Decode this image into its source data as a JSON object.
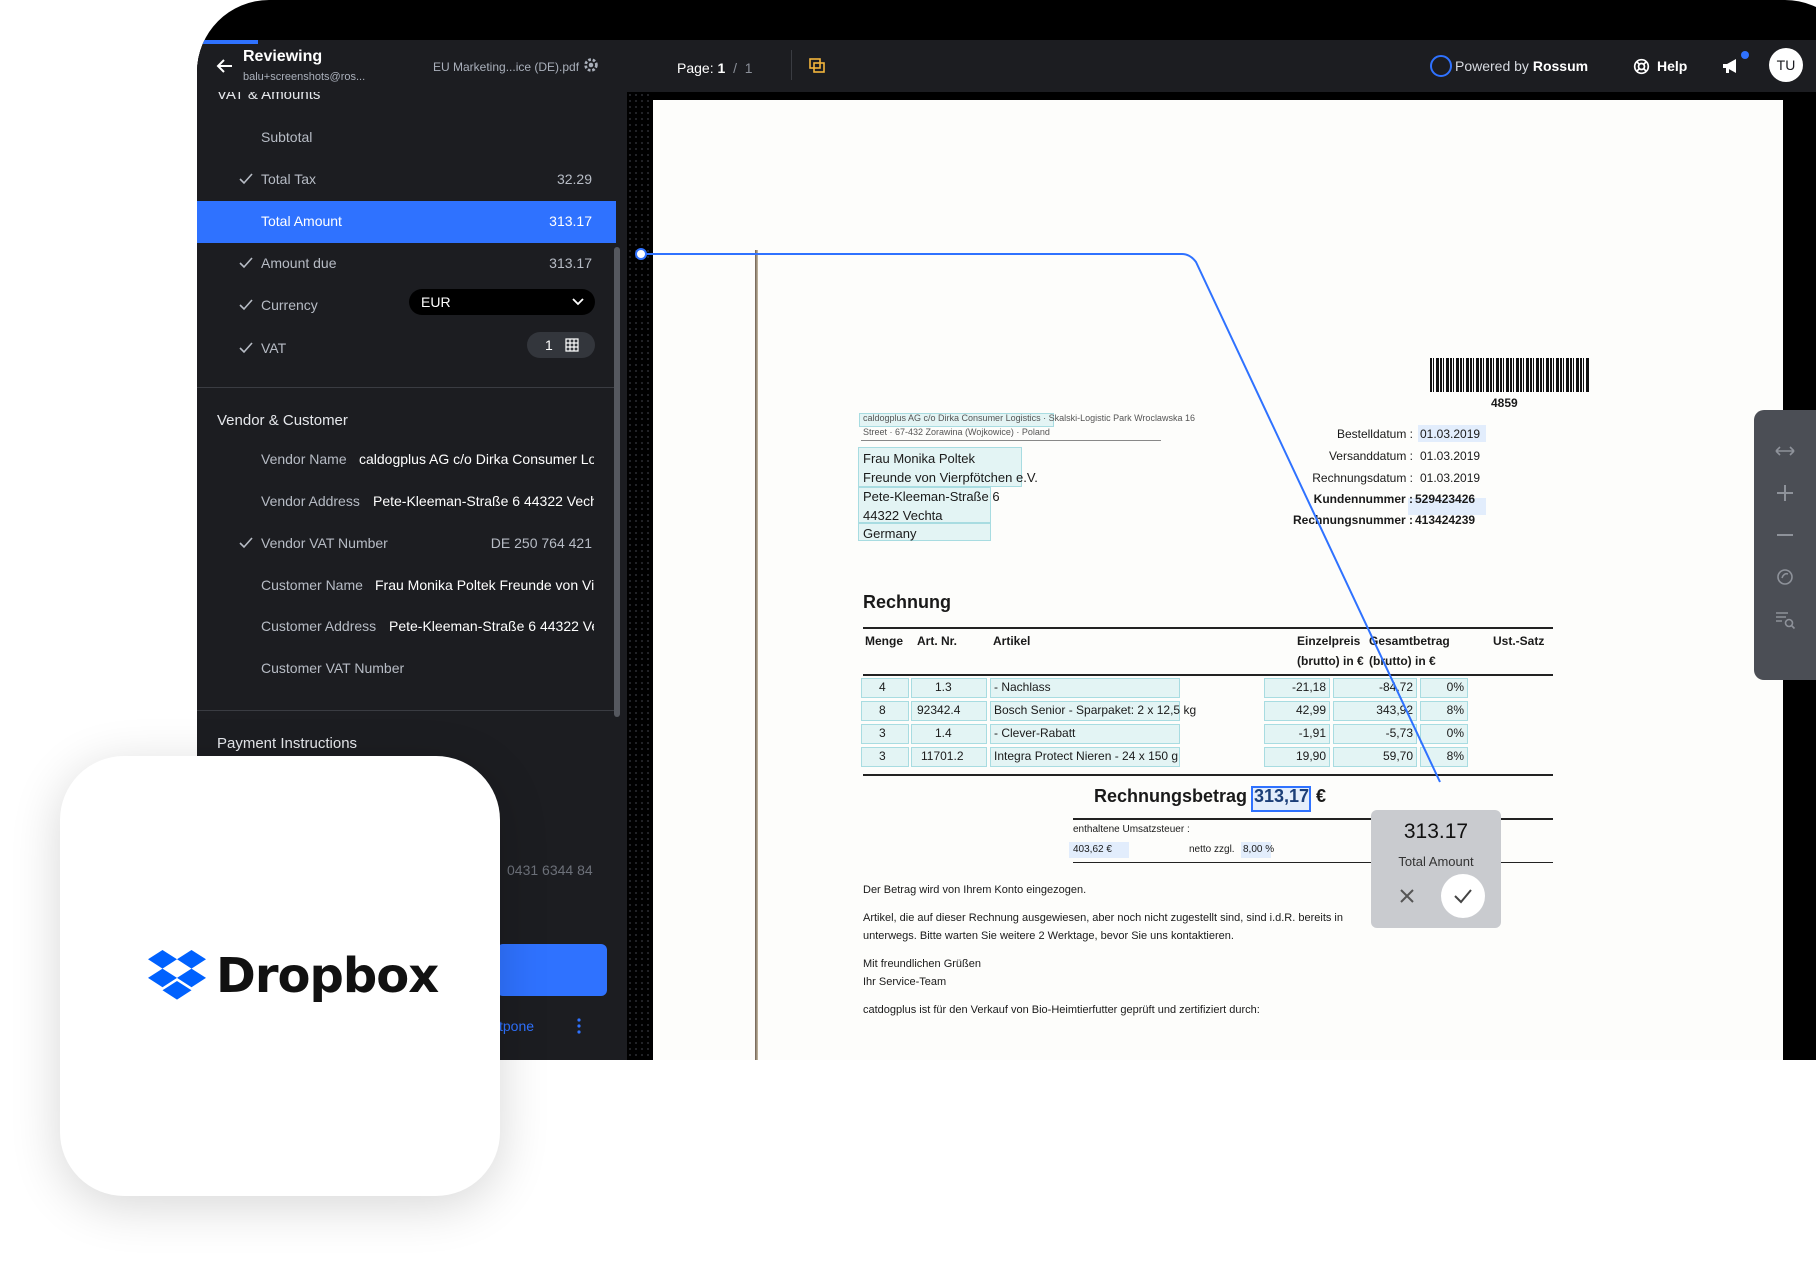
{
  "app": {
    "title": "Reviewing",
    "user": "balu+screenshots@ros...",
    "filename": "EU Marketing...ice (DE).pdf",
    "page_label": "Page:",
    "page_current": "1",
    "page_separator": "/",
    "page_total": "1",
    "powered_prefix": "Powered by",
    "powered_brand": "Rossum",
    "help": "Help",
    "avatar": "TU",
    "accent": "#2f72ff"
  },
  "sidebar": {
    "vat_section": "VAT & Amounts",
    "vat_rows": [
      {
        "label": "Subtotal",
        "value": "",
        "checked": false
      },
      {
        "label": "Total Tax",
        "value": "32.29",
        "checked": true
      },
      {
        "label": "Total Amount",
        "value": "313.17",
        "checked": false,
        "active": true
      },
      {
        "label": "Amount due",
        "value": "313.17",
        "checked": true
      }
    ],
    "currency": {
      "label": "Currency",
      "value": "EUR"
    },
    "vat": {
      "label": "VAT",
      "count": "1"
    },
    "vendor_section": "Vendor & Customer",
    "vendor_rows": [
      {
        "label": "Vendor Name",
        "value": "caldogplus AG c/o Dirka Consumer Lo"
      },
      {
        "label": "Vendor Address",
        "value": "Pete-Kleeman-Straße 6 44322 Vecht"
      },
      {
        "label": "Vendor VAT Number",
        "value": "DE 250 764 421"
      },
      {
        "label": "Customer Name",
        "value": "Frau Monika Poltek Freunde von Vie"
      },
      {
        "label": "Customer Address",
        "value": "Pete-Kleeman-Straße 6 44322 Ve"
      },
      {
        "label": "Customer VAT Number",
        "value": ""
      }
    ],
    "payment_section": "Payment Instructions",
    "partial_number": "0431 6344 84",
    "postpone_partial": "tpone"
  },
  "document": {
    "sender_line1": "caldogplus AG c/o Dirka Consumer Logistics · Skalski-Logistic Park Wroclawska 16",
    "sender_line2": "Street · 67-432 Zorawina (Wojkowice) · Poland",
    "address": [
      "Frau Monika Poltek",
      "Freunde von Vierpfötchen e.V.",
      "Pete-Kleeman-Straße 6",
      "44322 Vechta",
      "Germany"
    ],
    "barcode_number": "4859",
    "meta": [
      {
        "label": "Bestelldatum :",
        "value": "01.03.2019"
      },
      {
        "label": "Versanddatum :",
        "value": "01.03.2019"
      },
      {
        "label": "Rechnungsdatum :",
        "value": "01.03.2019"
      },
      {
        "label": "Kundennummer :",
        "value": "529423426"
      },
      {
        "label": "Rechnungsnummer :",
        "value": "413424239"
      }
    ],
    "heading": "Rechnung",
    "columns": [
      "Menge",
      "Art. Nr.",
      "Artikel",
      "Einzelpreis (brutto) in €",
      "Gesamtbetrag (brutto) in €",
      "Ust.-Satz"
    ],
    "col_einzel_1": "Einzelpreis",
    "col_einzel_2": "(brutto) in €",
    "col_gesamt_1": "Gesamtbetrag",
    "col_gesamt_2": "(brutto) in €",
    "lines": [
      {
        "qty": "4",
        "art": "1.3",
        "item": "- Nachlass",
        "unit": "-21,18",
        "total": "-84,72",
        "tax": "0%"
      },
      {
        "qty": "8",
        "art": "92342.4",
        "item": "Bosch Senior - Sparpaket: 2 x 12,5 kg",
        "unit": "42,99",
        "total": "343,92",
        "tax": "8%"
      },
      {
        "qty": "3",
        "art": "1.4",
        "item": "- Clever-Rabatt",
        "unit": "-1,91",
        "total": "-5,73",
        "tax": "0%"
      },
      {
        "qty": "3",
        "art": "11701.2",
        "item": "Integra Protect Nieren - 24 x 150 g",
        "unit": "19,90",
        "total": "59,70",
        "tax": "8%"
      }
    ],
    "total_label": "Rechnungsbetrag",
    "total_value": "313,17",
    "total_currency": "€",
    "tax_label": "enthaltene Umsatzsteuer :",
    "tax_amount": "403,62 €",
    "tax_net": "netto zzgl.",
    "tax_rate": "8,00 %",
    "para1": "Der Betrag wird von Ihrem Konto eingezogen.",
    "para2a": "Artikel, die auf dieser Rechnung ausgewiesen, aber noch nicht zugestellt sind, sind i.d.R. bereits in",
    "para2b": "unterwegs. Bitte warten Sie weitere 2 Werktage, bevor Sie uns kontaktieren.",
    "greet1": "Mit freundlichen Grüßen",
    "greet2": "Ihr Service-Team",
    "para3": "catdogplus ist für den Verkauf von Bio-Heimtierfutter geprüft und zertifiziert durch:",
    "tooltip_value": "313.17",
    "tooltip_label": "Total Amount"
  },
  "card": {
    "brand": "Dropbox",
    "brand_color": "#0061fe"
  }
}
